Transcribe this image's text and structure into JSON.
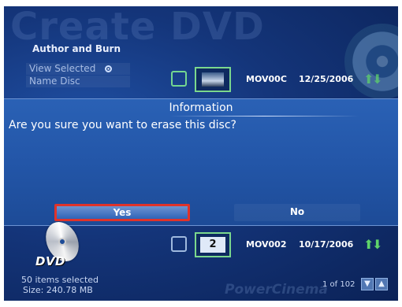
{
  "background_title": "Create DVD",
  "menu": {
    "author_burn": "Author and Burn",
    "view_selected": "View Selected",
    "name_disc": "Name Disc"
  },
  "rows": [
    {
      "name": "MOV00C",
      "date": "12/25/2006"
    },
    {
      "number": "2",
      "name": "MOV002",
      "date": "10/17/2006"
    }
  ],
  "dialog": {
    "title": "Information",
    "message": "Are you sure you want to erase this disc?",
    "yes_label": "Yes",
    "no_label": "No"
  },
  "disc_logo": "DVD",
  "footer": {
    "items_selected": "50 items selected",
    "size": "Size: 240.78 MB",
    "pager": "1 of 102",
    "watermark": "PowerCinema"
  },
  "icons": {
    "arrow_up": "▲",
    "arrow_down": "▼",
    "move_up_icon": "⬆",
    "move_down_icon": "⬇"
  }
}
